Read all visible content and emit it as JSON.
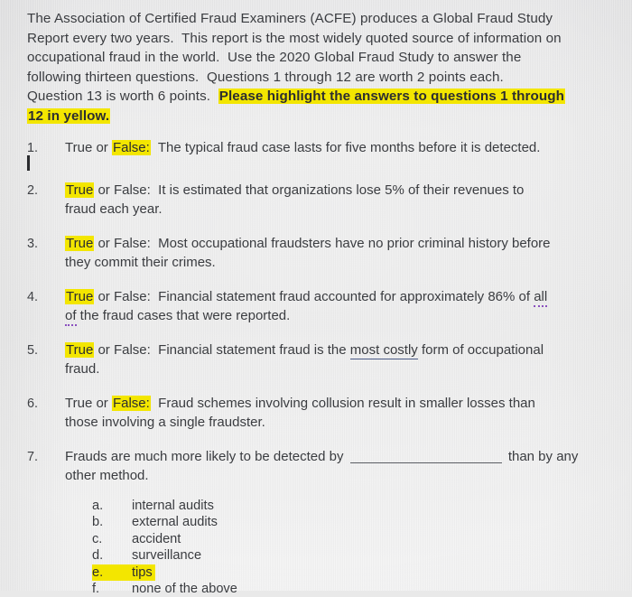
{
  "document": {
    "type": "scanned-exam-worksheet",
    "background_color": "#eaeaea",
    "highlight_color": "#f3e600",
    "text_color": "#3a3c40"
  },
  "intro": {
    "line1": "The Association of Certified Fraud Examiners (ACFE) produces a Global Fraud Study",
    "line2": "Report every two years.  This report is the most widely quoted source of information on",
    "line3": "occupational fraud in the world.  Use the 2020 Global Fraud Study to answer the",
    "line4": "following thirteen questions.  Questions 1 through 12 are worth 2 points each.",
    "line5_plain": "Question 13 is worth 6 points.  ",
    "line5_highlight": "Please highlight the answers to questions 1 through",
    "line6_highlight": "12 in yellow."
  },
  "questions": [
    {
      "number": "1.",
      "pre": "True or ",
      "highlight": "False:",
      "post": "  The typical fraud case lasts for five months before it is detected.",
      "line2": ""
    },
    {
      "number": "2.",
      "highlight": "True",
      "pre": "",
      "post": " or False:  It is estimated that organizations lose 5% of their revenues to",
      "line2": "fraud each year."
    },
    {
      "number": "3.",
      "highlight": "True",
      "pre": "",
      "post": " or False:  Most occupational fraudsters have no prior criminal history before",
      "line2": "they commit their crimes."
    },
    {
      "number": "4.",
      "highlight": "True",
      "pre": "",
      "post": " or False:  Financial statement fraud accounted for approximately 86% of ",
      "spell1": "all",
      "line2_spell": "of",
      "line2_rest": " the fraud cases that were reported."
    },
    {
      "number": "5.",
      "highlight": "True",
      "pre": "",
      "post": " or False:  Financial statement fraud is the ",
      "underlined": "most costly",
      "post2": " form of occupational",
      "line2": "fraud."
    },
    {
      "number": "6.",
      "pre": "True or ",
      "highlight": "False:",
      "post": "  Fraud schemes involving collusion result in smaller losses than",
      "line2": "those involving a single fraudster."
    },
    {
      "number": "7.",
      "pre": "Frauds are much more likely to be detected by ",
      "blank": "____________________",
      "post": " than by any",
      "line2": "other method."
    }
  ],
  "options": [
    {
      "letter": "a.",
      "text": "internal audits",
      "highlighted": false
    },
    {
      "letter": "b.",
      "text": "external audits",
      "highlighted": false
    },
    {
      "letter": "c.",
      "text": "accident",
      "highlighted": false
    },
    {
      "letter": "d.",
      "text": "surveillance",
      "highlighted": false
    },
    {
      "letter": "e.",
      "text": "tips",
      "highlighted": true
    },
    {
      "letter": "f.",
      "text": "none of the above",
      "highlighted": false
    }
  ],
  "cursor": {
    "present": true,
    "description": "text insertion caret below question 1"
  }
}
